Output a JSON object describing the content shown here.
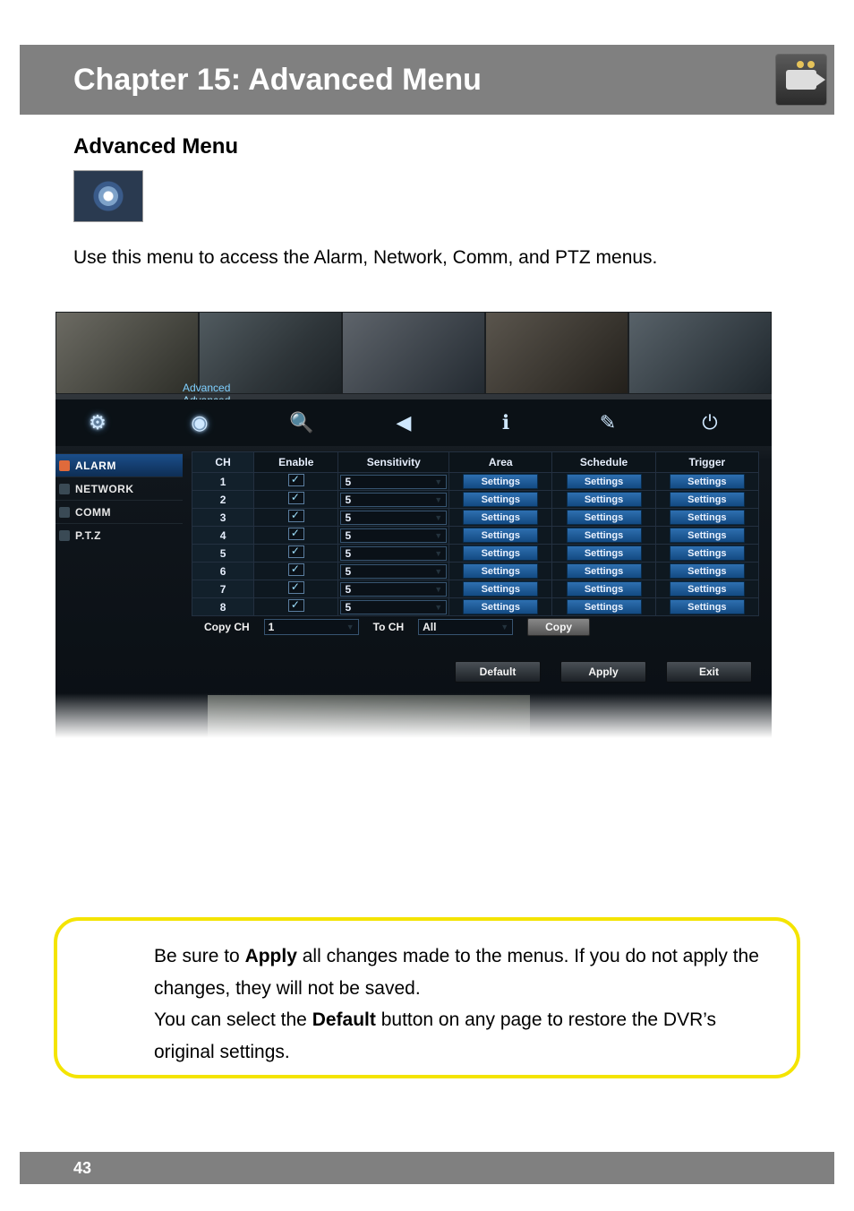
{
  "page": {
    "chapter_title": "Chapter 15: Advanced Menu",
    "section_title": "Advanced Menu",
    "intro": "Use this menu to access the Alarm, Network, Comm, and PTZ menus.",
    "page_number": "43"
  },
  "screenshot": {
    "breadcrumb_root": "Advanced",
    "breadcrumb_current": "Advanced",
    "sidebar": [
      {
        "label": "ALARM",
        "active": true
      },
      {
        "label": "NETWORK",
        "active": false
      },
      {
        "label": "COMM",
        "active": false
      },
      {
        "label": "P.T.Z",
        "active": false
      }
    ],
    "table": {
      "headers": {
        "ch": "CH",
        "enable": "Enable",
        "sensitivity": "Sensitivity",
        "area": "Area",
        "schedule": "Schedule",
        "trigger": "Trigger"
      },
      "settings_label": "Settings",
      "rows": [
        {
          "ch": "1",
          "enable": true,
          "sensitivity": "5"
        },
        {
          "ch": "2",
          "enable": true,
          "sensitivity": "5"
        },
        {
          "ch": "3",
          "enable": true,
          "sensitivity": "5"
        },
        {
          "ch": "4",
          "enable": true,
          "sensitivity": "5"
        },
        {
          "ch": "5",
          "enable": true,
          "sensitivity": "5"
        },
        {
          "ch": "6",
          "enable": true,
          "sensitivity": "5"
        },
        {
          "ch": "7",
          "enable": true,
          "sensitivity": "5"
        },
        {
          "ch": "8",
          "enable": true,
          "sensitivity": "5"
        }
      ]
    },
    "copy": {
      "copy_ch_label": "Copy CH",
      "copy_ch_value": "1",
      "to_ch_label": "To CH",
      "to_ch_value": "All",
      "copy_button": "Copy"
    },
    "actions": {
      "default": "Default",
      "apply": "Apply",
      "exit": "Exit"
    }
  },
  "callout": {
    "p1_a": "Be sure to ",
    "p1_bold": "Apply",
    "p1_b": " all changes made to the menus. If you do not apply the changes, they will not be saved.",
    "p2_a": "You can select the ",
    "p2_bold": "Default",
    "p2_b": " button on any page to restore the DVR’s original settings."
  }
}
